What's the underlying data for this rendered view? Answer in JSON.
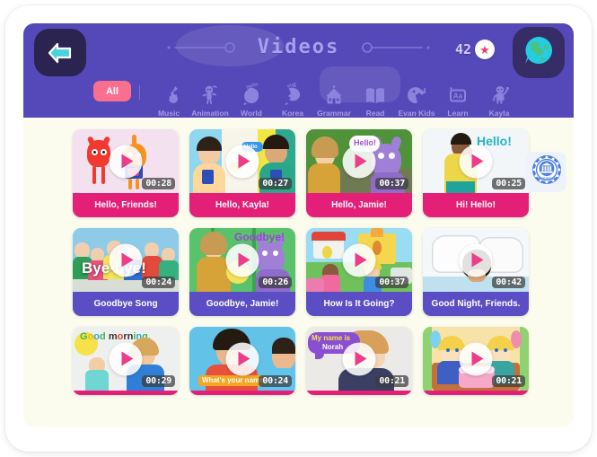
{
  "header": {
    "title": "Videos",
    "back_icon": "back-arrow-icon",
    "globe_icon": "globe-icon",
    "star_icon": "star-icon",
    "star_count": "42",
    "accent_purple": "#5548b8",
    "accent_pink": "#e31f78",
    "accent_indigo": "#5b4ec4",
    "filter_pink": "#fa6f8e"
  },
  "categories": {
    "all_label": "All",
    "items": [
      {
        "label": "Music",
        "icon": "guitar-icon"
      },
      {
        "label": "Animation",
        "icon": "robot-icon"
      },
      {
        "label": "World",
        "icon": "hello-speech-icon"
      },
      {
        "label": "Korea",
        "icon": "korea-speech-icon"
      },
      {
        "label": "Grammar",
        "icon": "house-icon"
      },
      {
        "label": "Read",
        "icon": "book-icon"
      },
      {
        "label": "Evan Kids",
        "icon": "pacman-icon"
      },
      {
        "label": "Learn",
        "icon": "aa-card-icon"
      },
      {
        "label": "Kayla",
        "icon": "kayla-character-icon"
      }
    ]
  },
  "seal_badge": {
    "icon": "certification-seal-icon"
  },
  "grid": {
    "rows": [
      {
        "clipped": false,
        "title_color": "pink",
        "cards": [
          {
            "title": "Hello, Friends!",
            "duration": "00:28",
            "overlay": ""
          },
          {
            "title": "Hello, Kayla!",
            "duration": "00:27",
            "overlay": "Hello"
          },
          {
            "title": "Hello, Jamie!",
            "duration": "00:37",
            "overlay": "Hello!"
          },
          {
            "title": "Hi! Hello!",
            "duration": "00:25",
            "overlay": "Hello!"
          }
        ]
      },
      {
        "clipped": false,
        "title_color": "purple",
        "cards": [
          {
            "title": "Goodbye Song",
            "duration": "00:24",
            "overlay": "Bye-bye!"
          },
          {
            "title": "Goodbye, Jamie!",
            "duration": "00:26",
            "overlay": "Goodbye!"
          },
          {
            "title": "How Is It Going?",
            "duration": "00:37",
            "overlay": ""
          },
          {
            "title": "Good Night, Friends.",
            "duration": "00:42",
            "overlay": ""
          }
        ]
      },
      {
        "clipped": true,
        "title_color": "pink",
        "cards": [
          {
            "title": "",
            "duration": "00:29",
            "overlay": "Good morning."
          },
          {
            "title": "",
            "duration": "00:24",
            "overlay": "What's your name?"
          },
          {
            "title": "",
            "duration": "00:21",
            "overlay": "My name is Norah"
          },
          {
            "title": "",
            "duration": "00:21",
            "overlay": ""
          }
        ]
      }
    ]
  }
}
